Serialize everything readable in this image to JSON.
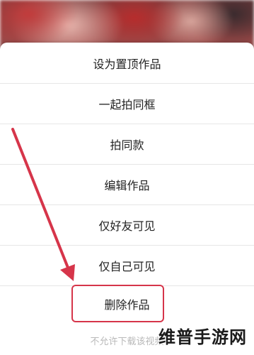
{
  "menu": {
    "items": [
      {
        "label": "设为置顶作品"
      },
      {
        "label": "一起拍同框"
      },
      {
        "label": "拍同款"
      },
      {
        "label": "编辑作品"
      },
      {
        "label": "仅好友可见"
      },
      {
        "label": "仅自己可见"
      },
      {
        "label": "删除作品"
      }
    ]
  },
  "footer": {
    "text": "不允许下载该视频"
  },
  "watermark": {
    "text": "维普手游网"
  },
  "annotation": {
    "color": "#d6354a"
  }
}
